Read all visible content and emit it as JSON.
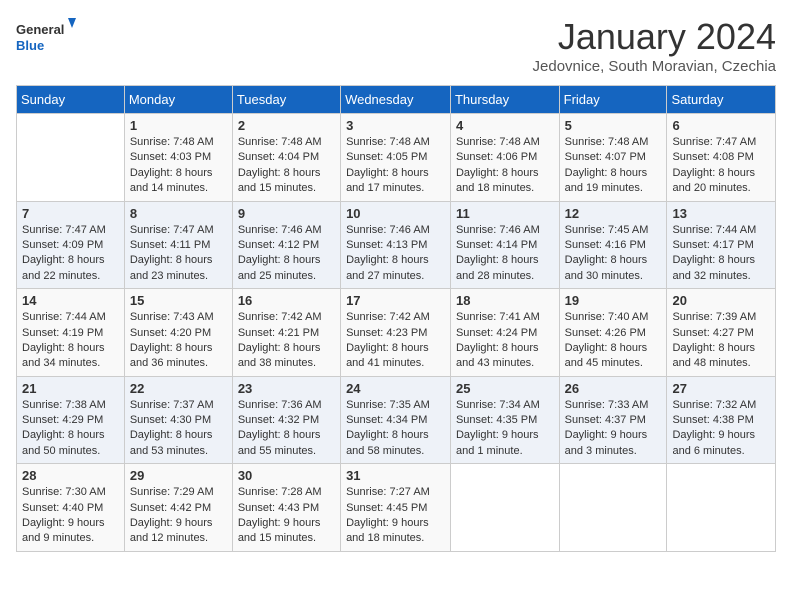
{
  "header": {
    "logo_general": "General",
    "logo_blue": "Blue",
    "month_title": "January 2024",
    "subtitle": "Jedovnice, South Moravian, Czechia"
  },
  "weekdays": [
    "Sunday",
    "Monday",
    "Tuesday",
    "Wednesday",
    "Thursday",
    "Friday",
    "Saturday"
  ],
  "weeks": [
    [
      {
        "day": "",
        "sunrise": "",
        "sunset": "",
        "daylight": ""
      },
      {
        "day": "1",
        "sunrise": "7:48 AM",
        "sunset": "4:03 PM",
        "daylight": "8 hours and 14 minutes."
      },
      {
        "day": "2",
        "sunrise": "7:48 AM",
        "sunset": "4:04 PM",
        "daylight": "8 hours and 15 minutes."
      },
      {
        "day": "3",
        "sunrise": "7:48 AM",
        "sunset": "4:05 PM",
        "daylight": "8 hours and 17 minutes."
      },
      {
        "day": "4",
        "sunrise": "7:48 AM",
        "sunset": "4:06 PM",
        "daylight": "8 hours and 18 minutes."
      },
      {
        "day": "5",
        "sunrise": "7:48 AM",
        "sunset": "4:07 PM",
        "daylight": "8 hours and 19 minutes."
      },
      {
        "day": "6",
        "sunrise": "7:47 AM",
        "sunset": "4:08 PM",
        "daylight": "8 hours and 20 minutes."
      }
    ],
    [
      {
        "day": "7",
        "sunrise": "7:47 AM",
        "sunset": "4:09 PM",
        "daylight": "8 hours and 22 minutes."
      },
      {
        "day": "8",
        "sunrise": "7:47 AM",
        "sunset": "4:11 PM",
        "daylight": "8 hours and 23 minutes."
      },
      {
        "day": "9",
        "sunrise": "7:46 AM",
        "sunset": "4:12 PM",
        "daylight": "8 hours and 25 minutes."
      },
      {
        "day": "10",
        "sunrise": "7:46 AM",
        "sunset": "4:13 PM",
        "daylight": "8 hours and 27 minutes."
      },
      {
        "day": "11",
        "sunrise": "7:46 AM",
        "sunset": "4:14 PM",
        "daylight": "8 hours and 28 minutes."
      },
      {
        "day": "12",
        "sunrise": "7:45 AM",
        "sunset": "4:16 PM",
        "daylight": "8 hours and 30 minutes."
      },
      {
        "day": "13",
        "sunrise": "7:44 AM",
        "sunset": "4:17 PM",
        "daylight": "8 hours and 32 minutes."
      }
    ],
    [
      {
        "day": "14",
        "sunrise": "7:44 AM",
        "sunset": "4:19 PM",
        "daylight": "8 hours and 34 minutes."
      },
      {
        "day": "15",
        "sunrise": "7:43 AM",
        "sunset": "4:20 PM",
        "daylight": "8 hours and 36 minutes."
      },
      {
        "day": "16",
        "sunrise": "7:42 AM",
        "sunset": "4:21 PM",
        "daylight": "8 hours and 38 minutes."
      },
      {
        "day": "17",
        "sunrise": "7:42 AM",
        "sunset": "4:23 PM",
        "daylight": "8 hours and 41 minutes."
      },
      {
        "day": "18",
        "sunrise": "7:41 AM",
        "sunset": "4:24 PM",
        "daylight": "8 hours and 43 minutes."
      },
      {
        "day": "19",
        "sunrise": "7:40 AM",
        "sunset": "4:26 PM",
        "daylight": "8 hours and 45 minutes."
      },
      {
        "day": "20",
        "sunrise": "7:39 AM",
        "sunset": "4:27 PM",
        "daylight": "8 hours and 48 minutes."
      }
    ],
    [
      {
        "day": "21",
        "sunrise": "7:38 AM",
        "sunset": "4:29 PM",
        "daylight": "8 hours and 50 minutes."
      },
      {
        "day": "22",
        "sunrise": "7:37 AM",
        "sunset": "4:30 PM",
        "daylight": "8 hours and 53 minutes."
      },
      {
        "day": "23",
        "sunrise": "7:36 AM",
        "sunset": "4:32 PM",
        "daylight": "8 hours and 55 minutes."
      },
      {
        "day": "24",
        "sunrise": "7:35 AM",
        "sunset": "4:34 PM",
        "daylight": "8 hours and 58 minutes."
      },
      {
        "day": "25",
        "sunrise": "7:34 AM",
        "sunset": "4:35 PM",
        "daylight": "9 hours and 1 minute."
      },
      {
        "day": "26",
        "sunrise": "7:33 AM",
        "sunset": "4:37 PM",
        "daylight": "9 hours and 3 minutes."
      },
      {
        "day": "27",
        "sunrise": "7:32 AM",
        "sunset": "4:38 PM",
        "daylight": "9 hours and 6 minutes."
      }
    ],
    [
      {
        "day": "28",
        "sunrise": "7:30 AM",
        "sunset": "4:40 PM",
        "daylight": "9 hours and 9 minutes."
      },
      {
        "day": "29",
        "sunrise": "7:29 AM",
        "sunset": "4:42 PM",
        "daylight": "9 hours and 12 minutes."
      },
      {
        "day": "30",
        "sunrise": "7:28 AM",
        "sunset": "4:43 PM",
        "daylight": "9 hours and 15 minutes."
      },
      {
        "day": "31",
        "sunrise": "7:27 AM",
        "sunset": "4:45 PM",
        "daylight": "9 hours and 18 minutes."
      },
      {
        "day": "",
        "sunrise": "",
        "sunset": "",
        "daylight": ""
      },
      {
        "day": "",
        "sunrise": "",
        "sunset": "",
        "daylight": ""
      },
      {
        "day": "",
        "sunrise": "",
        "sunset": "",
        "daylight": ""
      }
    ]
  ]
}
